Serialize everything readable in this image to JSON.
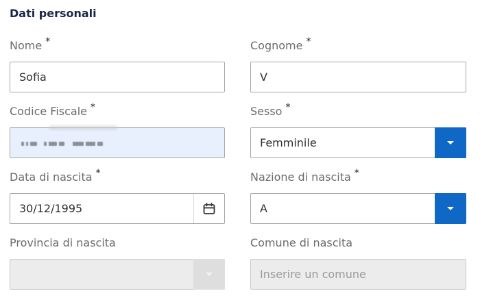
{
  "section": {
    "title": "Dati personali"
  },
  "required_mark": "*",
  "fields": {
    "nome": {
      "label": "Nome",
      "value": "Sofia"
    },
    "cognome": {
      "label": "Cognome",
      "value": "V"
    },
    "codice_fiscale": {
      "label": "Codice Fiscale",
      "value": ""
    },
    "sesso": {
      "label": "Sesso",
      "value": "Femminile"
    },
    "data_nascita": {
      "label": "Data di nascita",
      "value": "30/12/1995"
    },
    "nazione_nascita": {
      "label": "Nazione di nascita",
      "value": "A"
    },
    "provincia_nascita": {
      "label": "Provincia di nascita",
      "value": ""
    },
    "comune_nascita": {
      "label": "Comune di nascita",
      "placeholder": "Inserire un comune"
    }
  },
  "icons": {
    "select": "chevron-down-icon",
    "date": "calendar-icon"
  },
  "colors": {
    "accent": "#1068c6",
    "title": "#1b2545",
    "autofill": "#e8f0fe",
    "disabled": "#ececec"
  }
}
